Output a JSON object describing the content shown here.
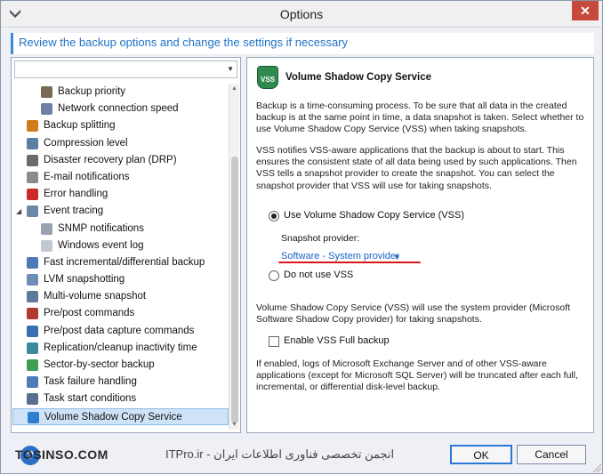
{
  "window": {
    "title": "Options",
    "close_label": "✕"
  },
  "banner": {
    "text": "Review the backup options and change the settings if necessary"
  },
  "sidebar": {
    "items": [
      {
        "label": "Backup priority",
        "indent": 2,
        "icon": "priority-icon",
        "color": "#7a6a55",
        "selected": false,
        "expander": ""
      },
      {
        "label": "Network connection speed",
        "indent": 2,
        "icon": "network-icon",
        "color": "#6f7fa6",
        "selected": false,
        "expander": ""
      },
      {
        "label": "Backup splitting",
        "indent": 1,
        "icon": "split-icon",
        "color": "#d27b1c",
        "selected": false,
        "expander": ""
      },
      {
        "label": "Compression level",
        "indent": 1,
        "icon": "compression-icon",
        "color": "#5b7fa3",
        "selected": false,
        "expander": ""
      },
      {
        "label": "Disaster recovery plan (DRP)",
        "indent": 1,
        "icon": "drp-icon",
        "color": "#6b6b6b",
        "selected": false,
        "expander": ""
      },
      {
        "label": "E-mail notifications",
        "indent": 1,
        "icon": "email-icon",
        "color": "#8b8b8b",
        "selected": false,
        "expander": ""
      },
      {
        "label": "Error handling",
        "indent": 1,
        "icon": "error-icon",
        "color": "#cc2a2a",
        "selected": false,
        "expander": ""
      },
      {
        "label": "Event tracing",
        "indent": 1,
        "icon": "event-tracing-icon",
        "color": "#6d87a8",
        "selected": false,
        "expander": "◢"
      },
      {
        "label": "SNMP notifications",
        "indent": 2,
        "icon": "snmp-icon",
        "color": "#9aa3b0",
        "selected": false,
        "expander": ""
      },
      {
        "label": "Windows event log",
        "indent": 2,
        "icon": "event-log-icon",
        "color": "#c2c8d1",
        "selected": false,
        "expander": ""
      },
      {
        "label": "Fast incremental/differential backup",
        "indent": 1,
        "icon": "fast-backup-icon",
        "color": "#4f79b5",
        "selected": false,
        "expander": ""
      },
      {
        "label": "LVM snapshotting",
        "indent": 1,
        "icon": "lvm-icon",
        "color": "#6b8db8",
        "selected": false,
        "expander": ""
      },
      {
        "label": "Multi-volume snapshot",
        "indent": 1,
        "icon": "multi-volume-icon",
        "color": "#5d7a9c",
        "selected": false,
        "expander": ""
      },
      {
        "label": "Pre/post commands",
        "indent": 1,
        "icon": "commands-icon",
        "color": "#b03a2e",
        "selected": false,
        "expander": ""
      },
      {
        "label": "Pre/post data capture commands",
        "indent": 1,
        "icon": "capture-commands-icon",
        "color": "#3c6eb4",
        "selected": false,
        "expander": ""
      },
      {
        "label": "Replication/cleanup inactivity time",
        "indent": 1,
        "icon": "replication-icon",
        "color": "#3b8a9e",
        "selected": false,
        "expander": ""
      },
      {
        "label": "Sector-by-sector backup",
        "indent": 1,
        "icon": "sector-icon",
        "color": "#3f9e52",
        "selected": false,
        "expander": ""
      },
      {
        "label": "Task failure handling",
        "indent": 1,
        "icon": "task-failure-icon",
        "color": "#4d7cb8",
        "selected": false,
        "expander": ""
      },
      {
        "label": "Task start conditions",
        "indent": 1,
        "icon": "task-start-icon",
        "color": "#5a6f8f",
        "selected": false,
        "expander": ""
      },
      {
        "label": "Volume Shadow Copy Service",
        "indent": 1,
        "icon": "vss-icon",
        "color": "#2f7fd0",
        "selected": true,
        "expander": ""
      }
    ]
  },
  "content": {
    "logo_text": "VSS",
    "title": "Volume Shadow Copy Service",
    "para1": "Backup is a time-consuming process. To be sure that all data in the created backup is at the same point in time, a data snapshot is taken. Select whether to use Volume Shadow Copy Service (VSS) when taking snapshots.",
    "para2": "VSS notifies VSS-aware applications that the backup is about to start. This ensures the consistent state of all data being used by such applications. Then VSS tells a snapshot provider to create the snapshot. You can select the snapshot provider that VSS will use for taking snapshots.",
    "radio_use_vss": "Use Volume Shadow Copy Service (VSS)",
    "snapshot_provider_label": "Snapshot provider:",
    "snapshot_provider_value": "Software - System provider",
    "radio_no_vss": "Do not use VSS",
    "para3": "Volume Shadow Copy Service (VSS) will use the system provider (Microsoft Software Shadow Copy provider) for taking snapshots.",
    "checkbox_full_backup": "Enable VSS Full backup",
    "para4": "If enabled, logs of Microsoft Exchange Server and of other VSS-aware applications (except for Microsoft SQL Server) will be truncated after each full, incremental, or differential disk-level backup."
  },
  "footer": {
    "help_label": "?",
    "watermark_left": "TOSINSO.COM",
    "watermark_right": "ITPro.ir - انجمن تخصصی فناوری اطلاعات ایران",
    "ok_label": "OK",
    "cancel_label": "Cancel"
  }
}
